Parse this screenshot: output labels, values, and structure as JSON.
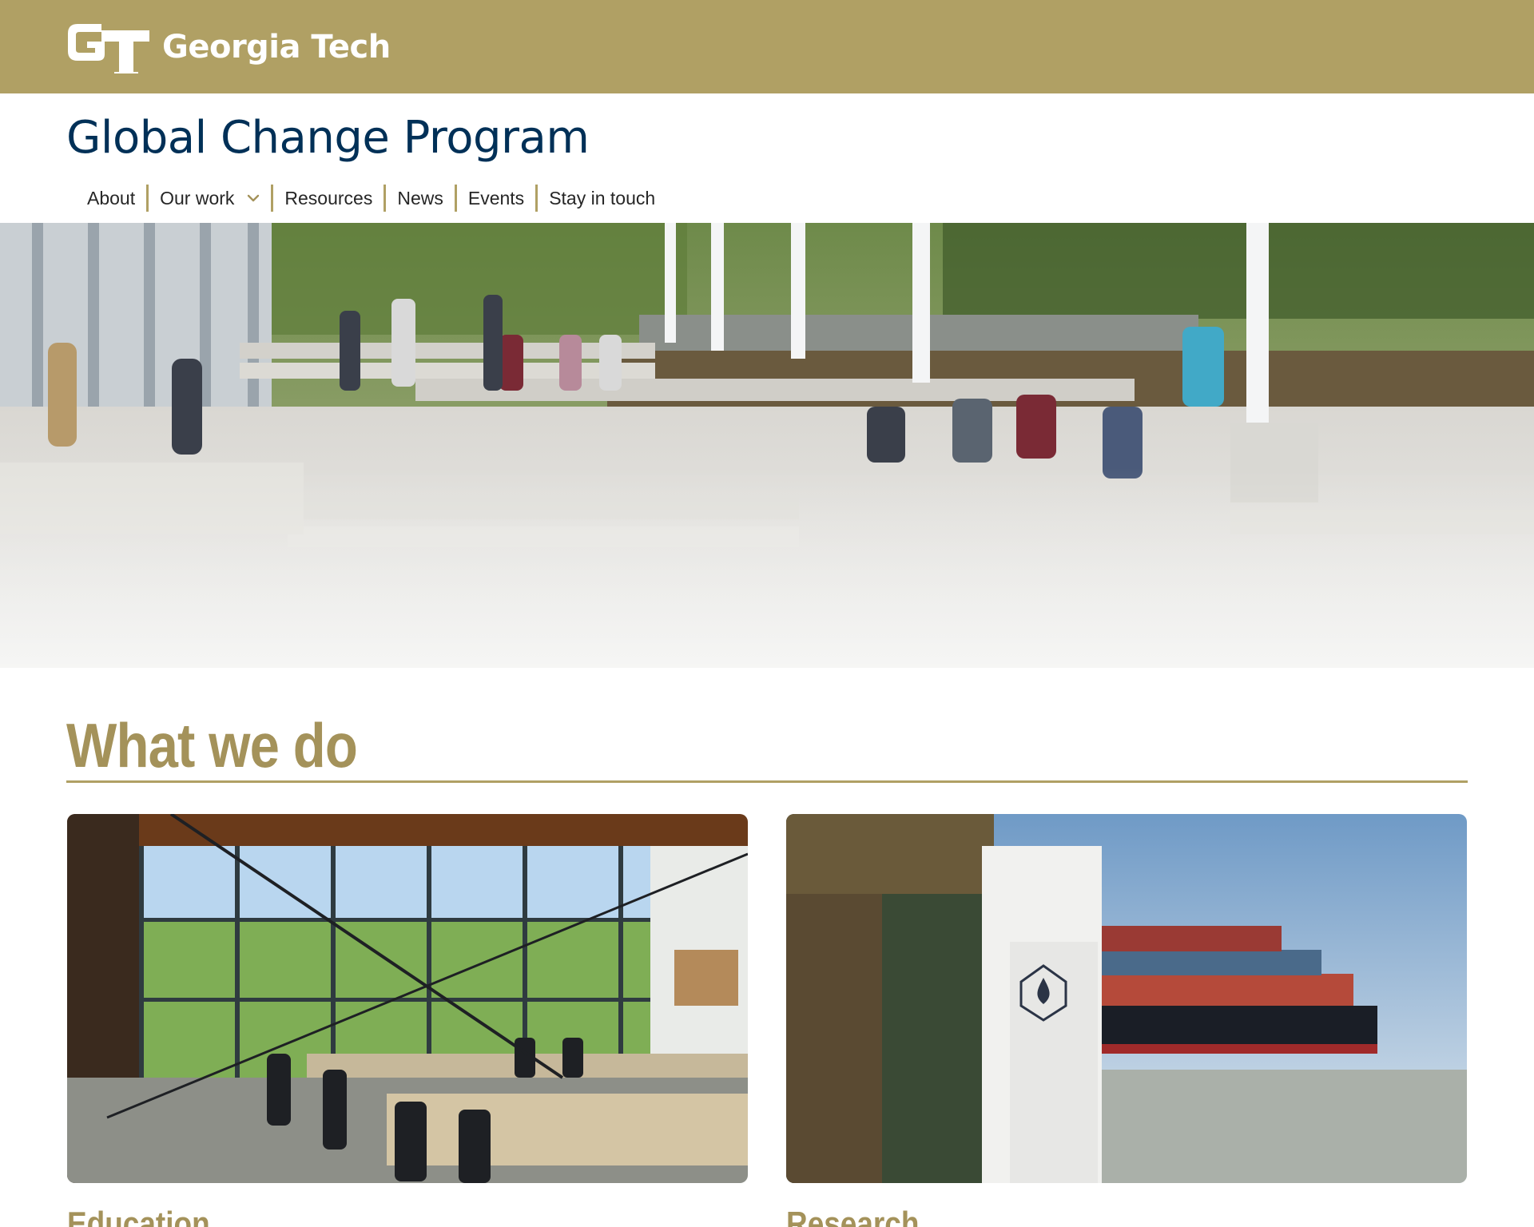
{
  "header": {
    "brand": "Georgia Tech",
    "brand_mark": "GT",
    "brand_color": "#b0a064"
  },
  "site": {
    "title": "Global Change Program",
    "title_color": "#003057"
  },
  "nav": {
    "items": [
      {
        "label": "About"
      },
      {
        "label": "Our work",
        "icon": "chevron-down-icon"
      },
      {
        "label": "Resources"
      },
      {
        "label": "News"
      },
      {
        "label": "Events"
      },
      {
        "label": "Stay in touch"
      }
    ]
  },
  "section": {
    "title": "What we do",
    "accent_color": "#a4925a"
  },
  "cards": [
    {
      "title": "Education"
    },
    {
      "title": "Research"
    }
  ]
}
